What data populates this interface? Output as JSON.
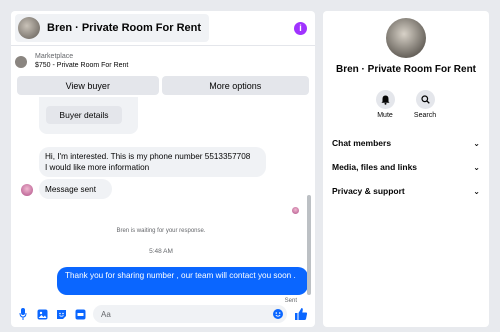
{
  "header": {
    "title": "Bren · Private Room For Rent",
    "info_glyph": "i"
  },
  "marketplace": {
    "label": "Marketplace",
    "price_title": "$750 - Private Room For Rent"
  },
  "actions": {
    "view_buyer": "View buyer",
    "more_options": "More options"
  },
  "messages": {
    "buyer_details": "Buyer details",
    "incoming_1_line1": "Hi, I'm interested. This is my phone number 5513357708",
    "incoming_1_line2": "I would like more information",
    "incoming_2": "Message sent",
    "waiting_notice": "Bren is waiting for your response.",
    "timestamp": "5:48 AM",
    "outgoing_1": "Thank you for sharing number , our team will contact you soon .",
    "outgoing_status": "Sent"
  },
  "composer": {
    "placeholder": "Aa"
  },
  "panel": {
    "title": "Bren · Private Room For Rent",
    "mute_label": "Mute",
    "search_label": "Search",
    "sections": [
      "Chat members",
      "Media, files and links",
      "Privacy & support"
    ]
  },
  "colors": {
    "accent": "#0a66ff",
    "info": "#a033ff",
    "bubble_in": "#f0f2f5"
  }
}
